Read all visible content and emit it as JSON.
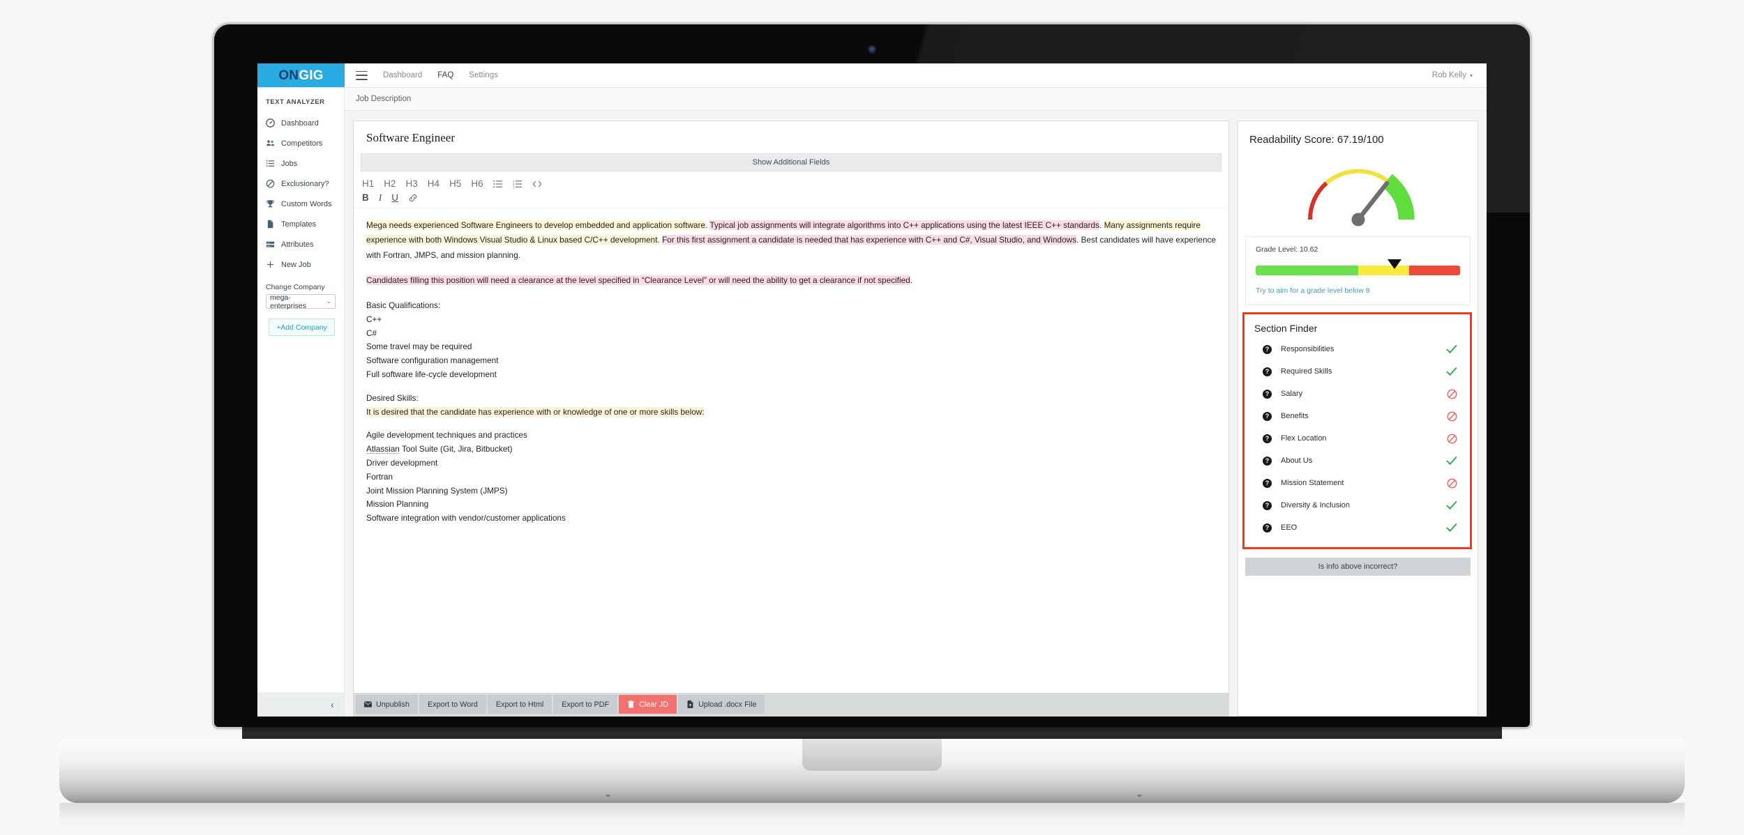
{
  "topbar": {
    "brand_on": "ON",
    "brand_gig": "GIG",
    "menu_icon": "hamburger-icon",
    "nav": [
      {
        "label": "Dashboard",
        "active": false
      },
      {
        "label": "FAQ",
        "active": true
      },
      {
        "label": "Settings",
        "active": false
      }
    ],
    "user": "Rob Kelly",
    "user_caret": "▾"
  },
  "sidebar": {
    "title": "TEXT ANALYZER",
    "items": [
      {
        "label": "Dashboard",
        "icon": "dashboard-icon"
      },
      {
        "label": "Competitors",
        "icon": "users-icon"
      },
      {
        "label": "Jobs",
        "icon": "list-icon"
      },
      {
        "label": "Exclusionary?",
        "icon": "ban-icon"
      },
      {
        "label": "Custom Words",
        "icon": "trophy-icon"
      },
      {
        "label": "Templates",
        "icon": "file-icon"
      },
      {
        "label": "Attributes",
        "icon": "bars-icon"
      },
      {
        "label": "New Job",
        "icon": "plus-icon"
      }
    ],
    "change_company_label": "Change Company",
    "company_selected": "mega-enterprises",
    "company_caret": "⌄",
    "add_company_label": "+Add Company",
    "collapse_icon": "‹"
  },
  "breadcrumb": "Job Description",
  "editor": {
    "job_title": "Software Engineer",
    "additional_fields_label": "Show Additional Fields",
    "toolbar_row1": [
      "H1",
      "H2",
      "H3",
      "H4",
      "H5",
      "H6"
    ],
    "toolbar_icons_row1": [
      "unordered-list-icon",
      "ordered-list-icon",
      "code-icon"
    ],
    "toolbar_row2": [
      "B",
      "I",
      "U"
    ],
    "toolbar_icons_row2": [
      "link-icon"
    ],
    "paragraph1": [
      {
        "text": "Mega needs experienced Software Engineers to develop embedded and application software",
        "hl": "yellow"
      },
      {
        "text": ". ",
        "hl": "none"
      },
      {
        "text": "Typical job assignments will integrate algorithms into C++ applications using the latest IEEE C++ standards",
        "hl": "pink"
      },
      {
        "text": ". ",
        "hl": "none"
      },
      {
        "text": "Many assignments require experience with both Windows Visual Studio & Linux based C/C++ development",
        "hl": "yellow"
      },
      {
        "text": ". ",
        "hl": "none"
      },
      {
        "text": "For this first assignment a candidate is needed that has experience with C++ and C#, Visual Studio, and Windows",
        "hl": "pink"
      },
      {
        "text": ". Best candidates will have experience with Fortran, JMPS, and mission planning.",
        "hl": "none"
      }
    ],
    "paragraph2": [
      {
        "text": "Candidates filling this position will need a clearance at the level specified in “Clearance Level” or will need the ability to get a clearance if not specified",
        "hl": "pink"
      },
      {
        "text": ".",
        "hl": "none"
      }
    ],
    "basic_qualifications_heading": "Basic Qualifications:",
    "basic_qualifications": [
      "C++",
      "C#",
      "Some travel may be required",
      "Software configuration management",
      "Full software life-cycle development"
    ],
    "desired_skills_heading": "Desired Skills:",
    "desired_skills_intro": "It is desired that the candidate has experience with or knowledge of one or more skills below:",
    "desired_skills": [
      "Agile development techniques and practices",
      "Atlassian Tool Suite (Git, Jira, Bitbucket)",
      "Driver development",
      "Fortran",
      "Joint Mission Planning System (JMPS)",
      "Mission Planning",
      "Software integration with vendor/customer applications"
    ],
    "misspelled_word": "Atlassian"
  },
  "footer_buttons": [
    {
      "label": "Unpublish",
      "icon": "envelope-icon",
      "variant": "default"
    },
    {
      "label": "Export to Word",
      "icon": "",
      "variant": "default"
    },
    {
      "label": "Export to Html",
      "icon": "",
      "variant": "default"
    },
    {
      "label": "Export to PDF",
      "icon": "",
      "variant": "default"
    },
    {
      "label": "Clear JD",
      "icon": "trash-icon",
      "variant": "danger"
    },
    {
      "label": "Upload .docx File",
      "icon": "upload-file-icon",
      "variant": "default"
    }
  ],
  "readability": {
    "title": "Readability Score: 67.19/100",
    "score": 67.19,
    "score_max": 100,
    "gauge": {
      "needle_angle_deg": 52,
      "segments": [
        {
          "name": "low",
          "color": "#d4322a",
          "from_deg": -90,
          "to_deg": -42
        },
        {
          "name": "mid",
          "color": "#f2e03c",
          "from_deg": -42,
          "to_deg": 38
        },
        {
          "name": "high",
          "color": "#5fdd3c",
          "from_deg": 38,
          "to_deg": 90
        }
      ]
    },
    "grade_label": "Grade Level: 10.62",
    "grade_value": 10.62,
    "grade_bar": [
      {
        "name": "good",
        "color": "#6ce04b",
        "width_pct": 50
      },
      {
        "name": "warn",
        "color": "#fbe93e",
        "width_pct": 25
      },
      {
        "name": "bad",
        "color": "#ec4a3a",
        "width_pct": 25
      }
    ],
    "grade_marker_pct": 68,
    "grade_tip": "Try to aim for a grade level below 8"
  },
  "section_finder": {
    "title": "Section Finder",
    "highlight_color": "#f03a16",
    "help_icon": "question-mark-icon",
    "items": [
      {
        "label": "Responsibilities",
        "status": "found",
        "icon": "check-icon"
      },
      {
        "label": "Required Skills",
        "status": "found",
        "icon": "check-icon"
      },
      {
        "label": "Salary",
        "status": "missing",
        "icon": "ban-icon"
      },
      {
        "label": "Benefits",
        "status": "missing",
        "icon": "ban-icon"
      },
      {
        "label": "Flex Location",
        "status": "missing",
        "icon": "ban-icon"
      },
      {
        "label": "About Us",
        "status": "found",
        "icon": "check-icon"
      },
      {
        "label": "Mission Statement",
        "status": "missing",
        "icon": "ban-icon"
      },
      {
        "label": "Diversity & Inclusion",
        "status": "found",
        "icon": "check-icon"
      },
      {
        "label": "EEO",
        "status": "found",
        "icon": "check-icon"
      }
    ],
    "incorrect_button": "Is info above incorrect?",
    "status_colors": {
      "found": "#2fa84f",
      "missing": "#e8635e"
    }
  }
}
